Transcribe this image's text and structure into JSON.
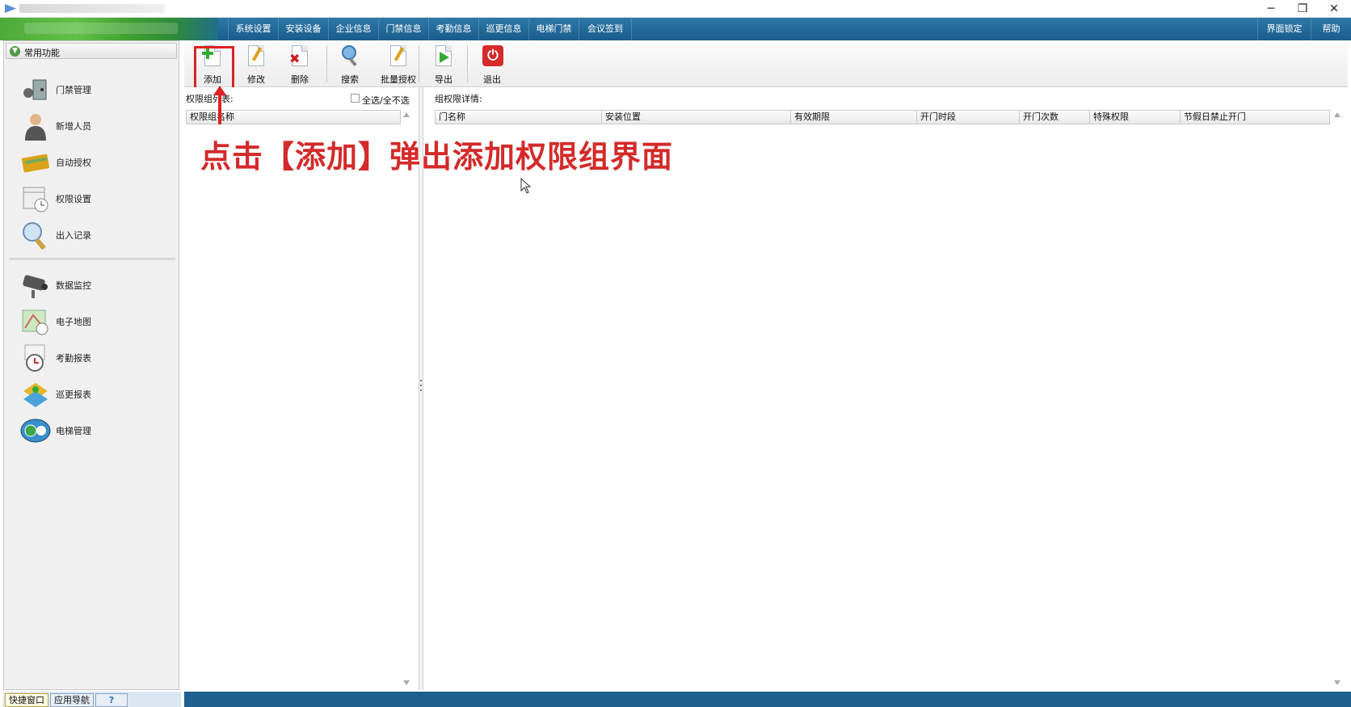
{
  "window": {
    "minimize": "─",
    "restore": "❐",
    "close": "✕"
  },
  "menu": {
    "items": [
      "系统设置",
      "安装设备",
      "企业信息",
      "门禁信息",
      "考勤信息",
      "巡更信息",
      "电梯门禁",
      "会议签到"
    ],
    "right_items": [
      "界面锁定",
      "帮助"
    ]
  },
  "sidebar": {
    "header": "常用功能",
    "items": [
      {
        "label": "门禁管理",
        "icon": "door-access-icon"
      },
      {
        "label": "新增人员",
        "icon": "person-icon"
      },
      {
        "label": "自动授权",
        "icon": "card-icon"
      },
      {
        "label": "权限设置",
        "icon": "calendar-clock-icon"
      },
      {
        "label": "出入记录",
        "icon": "magnifier-icon"
      },
      {
        "label": "数据监控",
        "icon": "camera-icon"
      },
      {
        "label": "电子地图",
        "icon": "map-icon"
      },
      {
        "label": "考勤报表",
        "icon": "clock-icon"
      },
      {
        "label": "巡更报表",
        "icon": "patrol-icon"
      },
      {
        "label": "电梯管理",
        "icon": "elevator-icon"
      }
    ]
  },
  "bottom_tabs": [
    "快捷窗口",
    "应用导航",
    "?"
  ],
  "toolbar": {
    "add": "添加",
    "edit": "修改",
    "delete": "删除",
    "search": "搜索",
    "batch_auth": "批量授权",
    "export": "导出",
    "exit": "退出"
  },
  "left_pane": {
    "title": "权限组列表:",
    "select_all": "全选/全不选",
    "columns": [
      "权限组名称"
    ]
  },
  "right_pane": {
    "title": "组权限详情:",
    "columns": [
      "门名称",
      "安装位置",
      "有效期限",
      "开门时段",
      "开门次数",
      "特殊权限",
      "节假日禁止开门"
    ]
  },
  "annotation": "点击【添加】弹出添加权限组界面",
  "colors": {
    "menu_bg": "#1a5d8a",
    "accent_red": "#d22222",
    "status_bar": "#1e5f8c"
  }
}
